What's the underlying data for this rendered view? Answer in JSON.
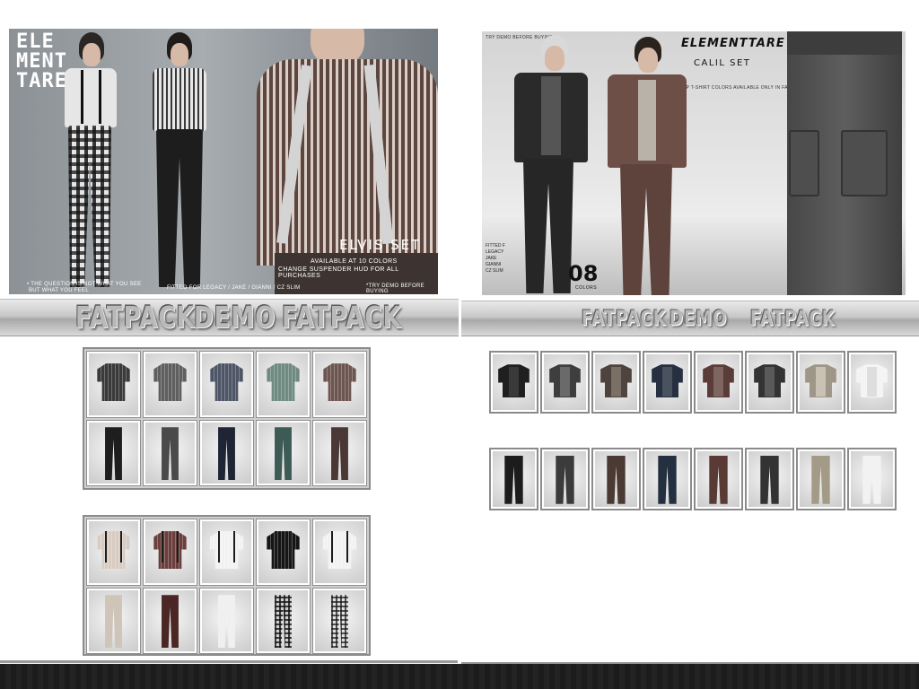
{
  "left_set": {
    "brand_lines": [
      "ELE",
      "MENT",
      "TARE"
    ],
    "title": "ELVIS SET",
    "info_line1": "AVAILABLE AT 10 COLORS",
    "info_line2": "CHANGE SUSPENDER HUD FOR ALL PURCHASES",
    "note_bottom_left_1": "• THE QUESTION IS NOT WHAT YOU SEE",
    "note_bottom_left_2": "BUT WHAT YOU FEEL",
    "fitted_note": "FITTED FOR LEGACY / JAKE / GIANNI / CZ SLIM",
    "try_demo": "*TRY DEMO BEFORE BUYING",
    "banner_words": [
      "FATPACK",
      "DEMO",
      "FATPACK"
    ],
    "group1_shirts": [
      "#3a3a3a",
      "#5f5f5f",
      "#4d5566",
      "#6f8a80",
      "#6e5650"
    ],
    "group1_pants": [
      "#1e1e1e",
      "#4a4a4a",
      "#1f2535",
      "#3d5a54",
      "#4a3834"
    ],
    "group2_shirts": [
      "#d8ccc2",
      "#6a3f3c",
      "#f2f2f2",
      "#151515",
      "#f2f2f2"
    ],
    "group2_pants": [
      "#cfc4b8",
      "#4a2724",
      "#f0f0f0",
      "#3a3a3a",
      "#e0e0e0"
    ]
  },
  "right_set": {
    "top_note": "TRY DEMO BEFORE BUYING",
    "brand": "ELEMENTTARE",
    "title": "CALIL SET",
    "subnote": "TANKTOP T-SHIRT COLORS AVAILABLE ONLY IN FATPACK",
    "fitted_lines": [
      "FITTED F",
      "LEGACY",
      "JAKE",
      "GIANNI",
      "CZ SLIM"
    ],
    "count": "08",
    "count_label": "COLORS",
    "banner_words": [
      "FATPACK",
      "DEMO",
      "FATPACK"
    ],
    "jackets": [
      "#1f1f1f",
      "#3e3e3e",
      "#4e433d",
      "#263040",
      "#5a3d38",
      "#333333",
      "#9e9686",
      "#f4f4f4"
    ],
    "jacket_inners": [
      "#3a3a3a",
      "#6a6a6a",
      "#7a7066",
      "#4a5260",
      "#7e6660",
      "#5a5a5a",
      "#c9c2b4",
      "#dedede"
    ],
    "pants": [
      "#1c1c1c",
      "#3b3b3b",
      "#4a3a33",
      "#24303f",
      "#5a3a34",
      "#333333",
      "#a39b87",
      "#f2f2f2"
    ]
  }
}
